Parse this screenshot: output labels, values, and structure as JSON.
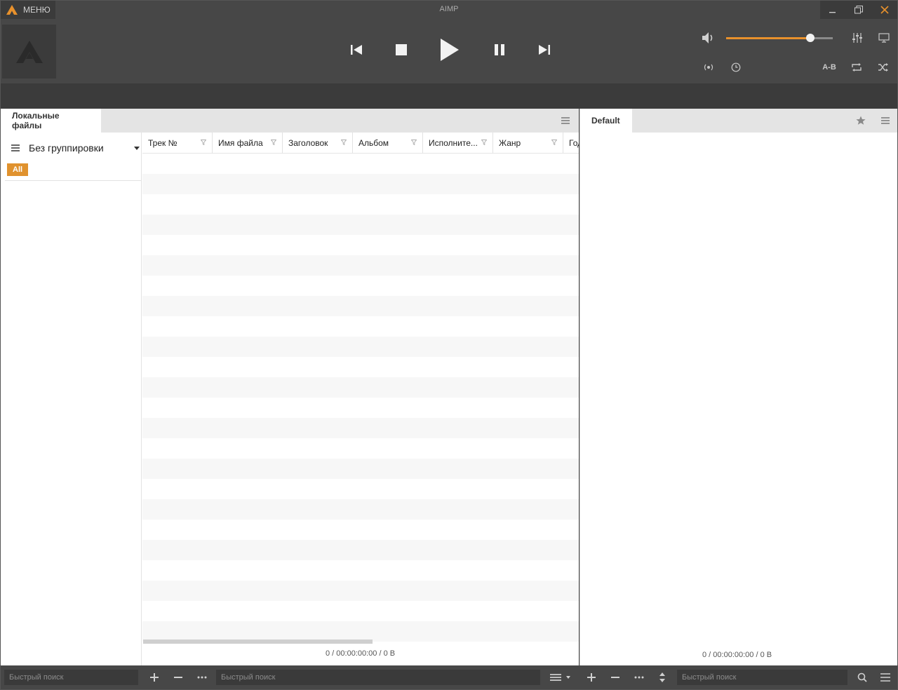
{
  "window": {
    "title": "AIMP",
    "menu_label": "МЕНЮ"
  },
  "player": {
    "volume_fraction": 0.79
  },
  "controls": {
    "ab_label": "A-B"
  },
  "left_pane": {
    "tab_label": "Локальные файлы",
    "grouping_label": "Без группировки",
    "all_badge": "All",
    "columns": [
      "Трек №",
      "Имя файла",
      "Заголовок",
      "Альбом",
      "Исполните...",
      "Жанр",
      "Год"
    ],
    "status": "0 / 00:00:00:00 / 0 B"
  },
  "right_pane": {
    "tab_label": "Default",
    "status": "0 / 00:00:00:00 / 0 B"
  },
  "bottom": {
    "search_placeholder_1": "Быстрый поиск",
    "search_placeholder_2": "Быстрый поиск",
    "search_placeholder_3": "Быстрый поиск"
  },
  "colors": {
    "accent": "#e8912c",
    "badge": "#e0922e",
    "header_bg": "#474747",
    "dark_bg": "#3b3b3b"
  }
}
